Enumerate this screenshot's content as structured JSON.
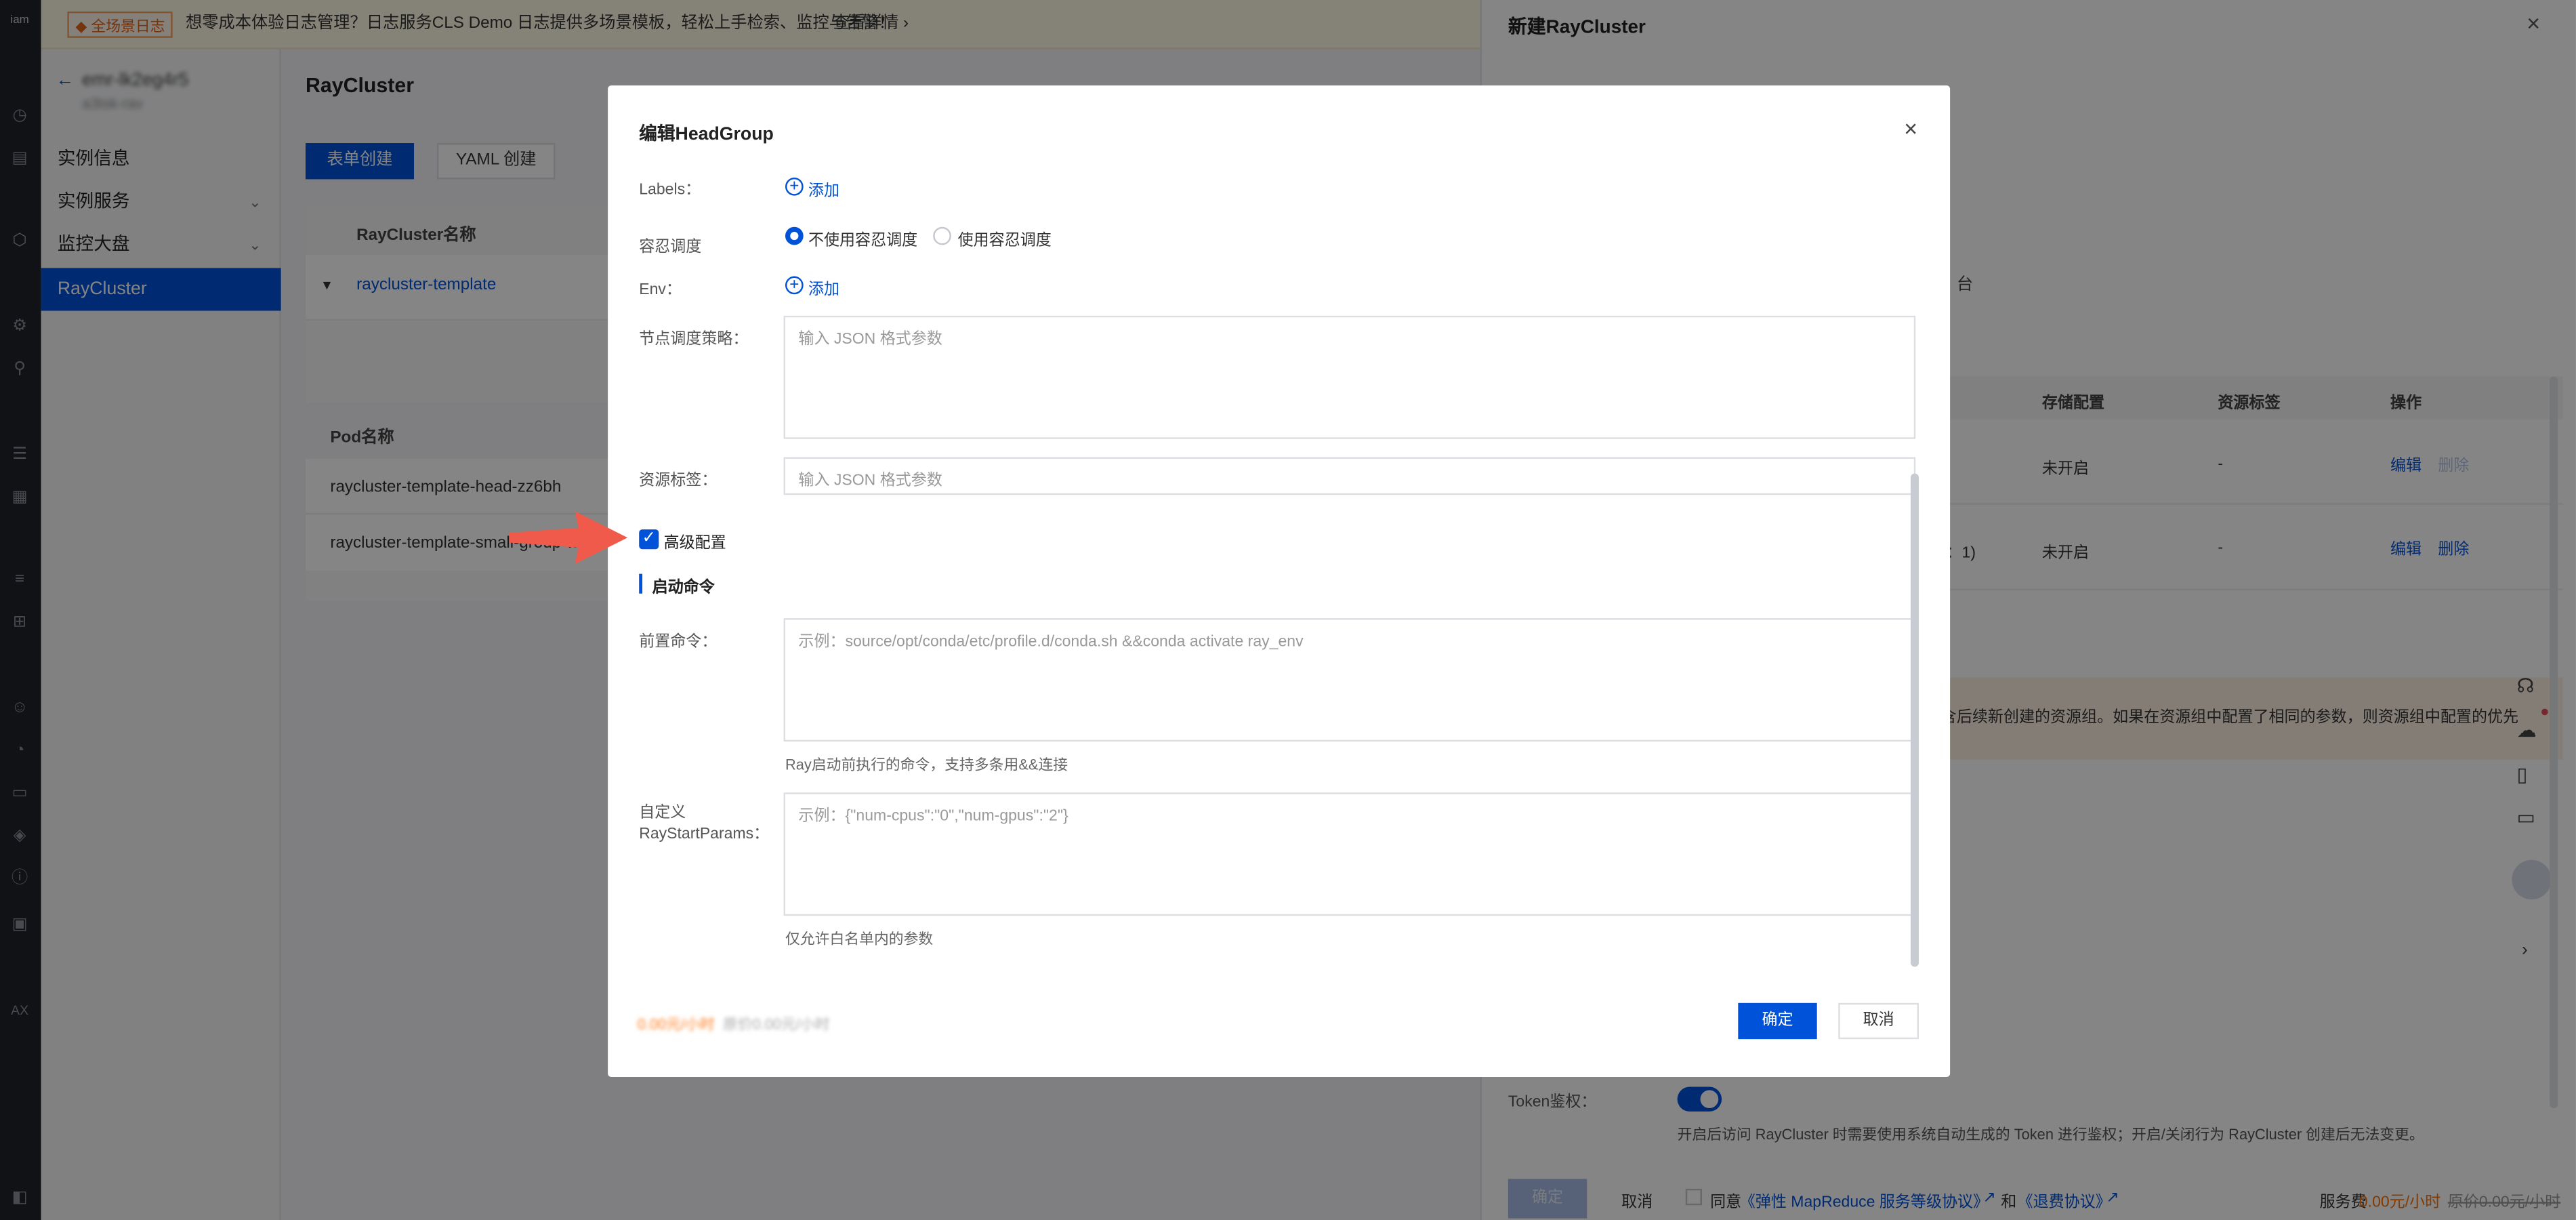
{
  "banner": {
    "tag": "◆ 全场景日志",
    "text": "想零成本体验日志管理？日志服务CLS Demo 日志提供多场景模板，轻松上手检索、监控与告警！",
    "link": "查看详情 ›"
  },
  "sidebar": {
    "back": "←",
    "instance_name": "emr-lk2eg4r5",
    "instance_sub": "a3tsk-rav",
    "items": [
      {
        "label": "实例信息"
      },
      {
        "label": "实例服务",
        "chevron": "⌄"
      },
      {
        "label": "监控大盘",
        "chevron": "⌄"
      },
      {
        "label": "RayCluster"
      }
    ]
  },
  "main": {
    "title": "RayCluster",
    "tab_form": "表单创建",
    "tab_yaml": "YAML 创建",
    "col_name": "RayCluster名称",
    "expand": "▼",
    "row_name": "raycluster-template",
    "pod_header": "Pod名称",
    "pods": [
      "raycluster-template-head-zz6bh",
      "raycluster-template-small-group-wo..."
    ]
  },
  "panel": {
    "title": "新建RayCluster",
    "close": "×",
    "partial_text": "台",
    "table_headers": [
      "存储配置",
      "资源标签",
      "操作"
    ],
    "rows": [
      {
        "prefix": "",
        "storage": "未开启",
        "label": "-",
        "edit": "编辑",
        "delete": "删除"
      },
      {
        "prefix": "AX：1)",
        "storage": "未开启",
        "label": "-",
        "edit": "编辑",
        "delete": "删除"
      }
    ],
    "notice": "包含后续新创建的资源组。如果在资源组中配置了相同的参数，则资源组中配置的优先",
    "token_label": "Token鉴权：",
    "token_desc": "开启后访问 RayCluster 时需要使用系统自动生成的 Token 进行鉴权；开启/关闭行为 RayCluster 创建后无法变更。",
    "footer_ok": "确定",
    "footer_cancel": "取消",
    "agree": "同意",
    "agreement1": "《弹性 MapReduce 服务等级协议》",
    "and": "和",
    "agreement2": "《退费协议》",
    "fee_label": "服务费",
    "fee_value": "0.00元/小时",
    "fee_old": "原价0.00元/小时"
  },
  "modal": {
    "title": "编辑HeadGroup",
    "close": "×",
    "labels_label": "Labels：",
    "labels_add": "添加",
    "tolerance_label": "容忍调度",
    "tolerance_options": [
      "不使用容忍调度",
      "使用容忍调度"
    ],
    "env_label": "Env：",
    "env_add": "添加",
    "node_policy_label": "节点调度策略：",
    "node_policy_placeholder": "输入 JSON 格式参数",
    "resource_tag_label": "资源标签：",
    "resource_tag_placeholder": "输入 JSON 格式参数",
    "advanced_label": "高级配置",
    "advanced_checked": true,
    "section_title": "启动命令",
    "precmd_label": "前置命令：",
    "precmd_placeholder": "示例：source/opt/conda/etc/profile.d/conda.sh &&conda activate ray_env",
    "precmd_help": "Ray启动前执行的命令，支持多条用&&连接",
    "custom_label": "自定义 RayStartParams：",
    "custom_placeholder": "示例：{\"num-cpus\":\"0\",\"num-gpus\":\"2\"}",
    "custom_help": "仅允许白名单内的参数",
    "footer_fee": "0.00元/小时",
    "footer_fee_old": "原价0.00元/小时",
    "ok": "确定",
    "cancel": "取消"
  }
}
